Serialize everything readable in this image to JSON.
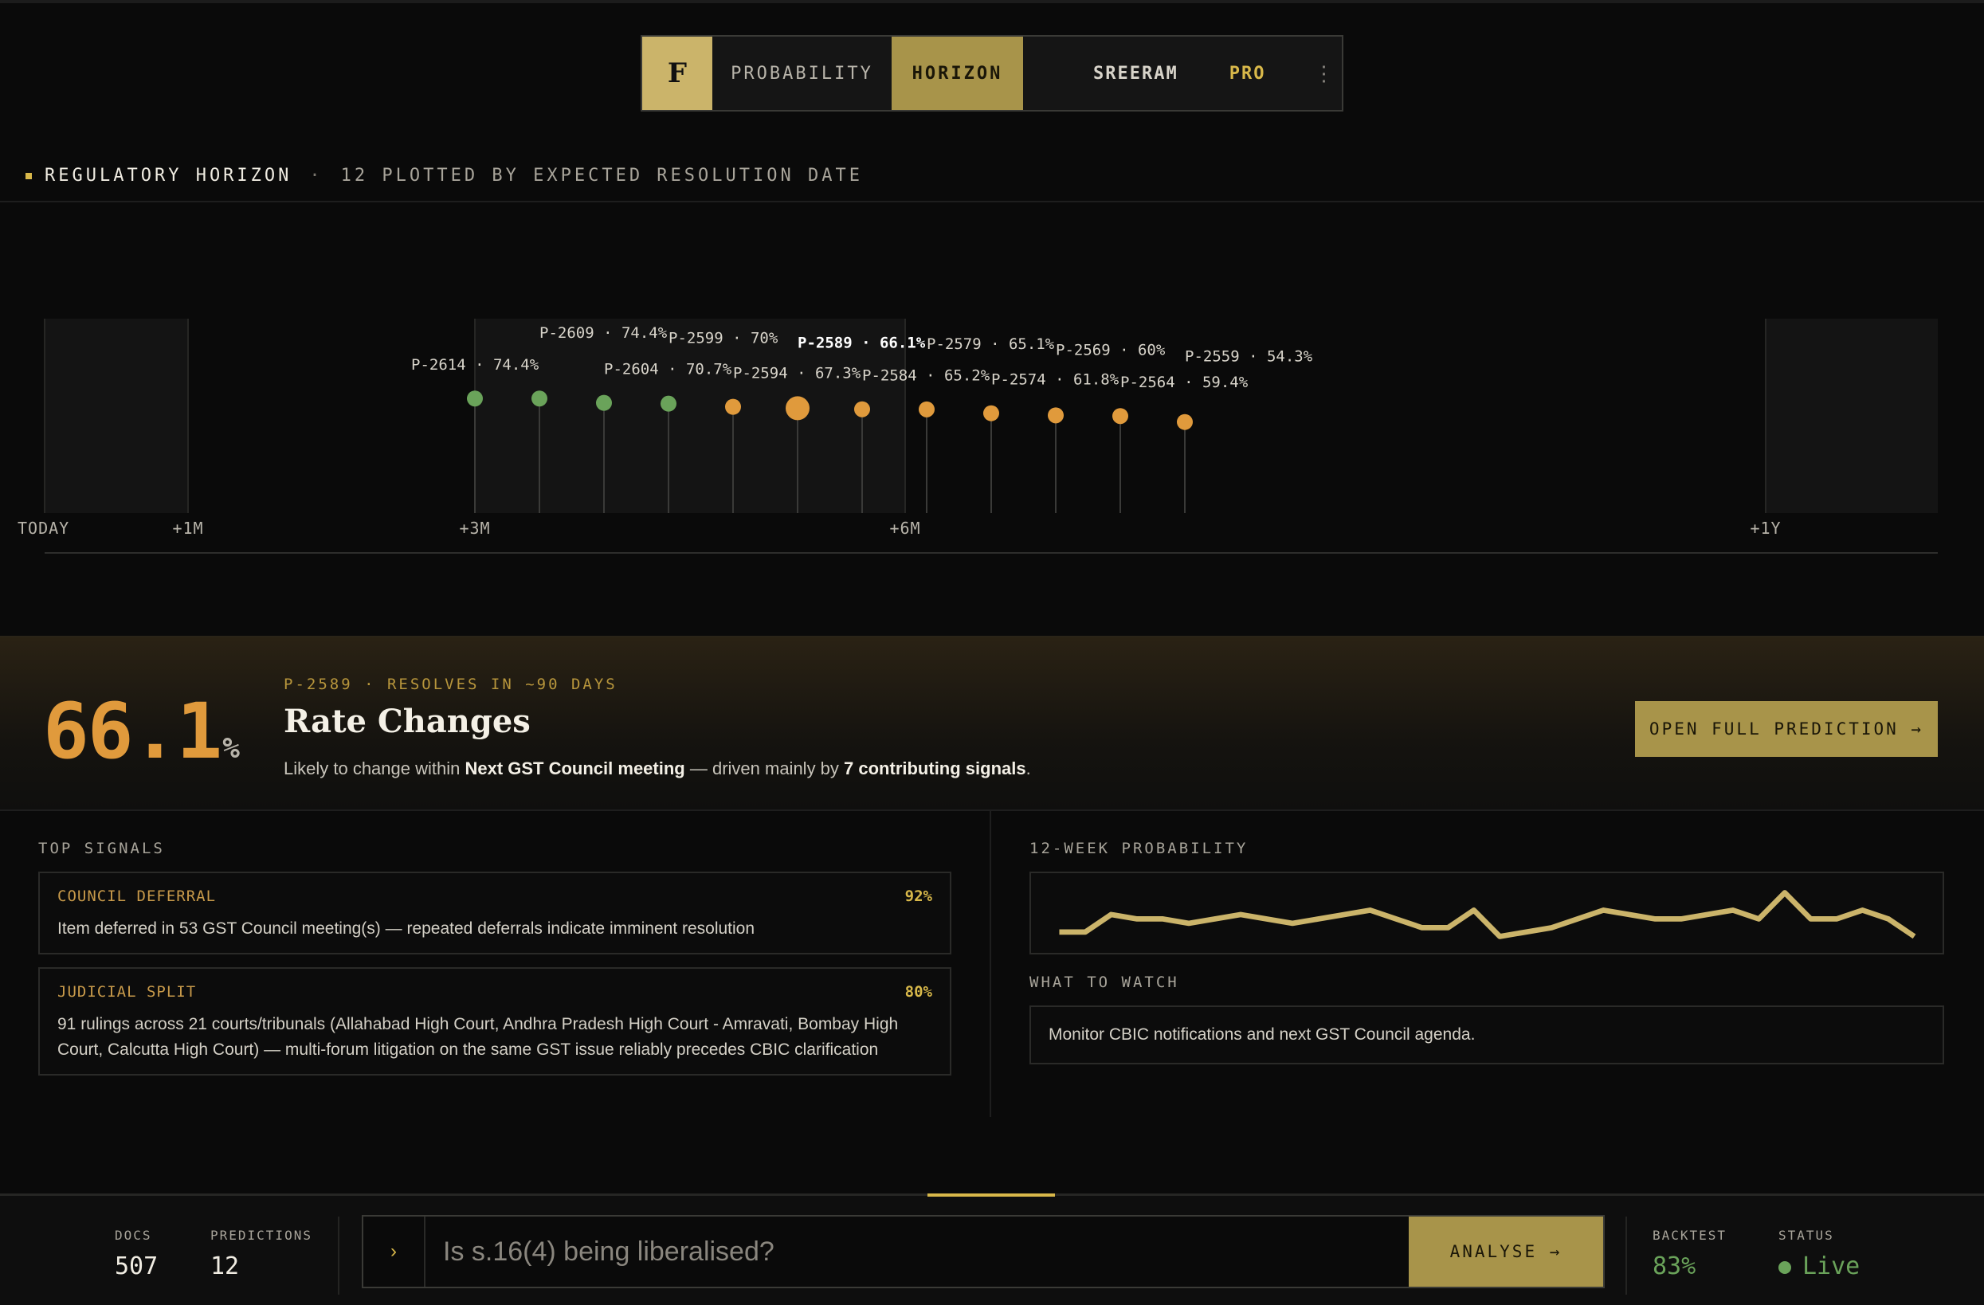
{
  "nav": {
    "logo": "F",
    "tabs": [
      {
        "label": "PROBABILITY"
      },
      {
        "label": "HORIZON"
      }
    ],
    "user": "SREERAM",
    "plan": "PRO",
    "menu_glyph": "⋮"
  },
  "section": {
    "title": "REGULATORY HORIZON",
    "separator": "·",
    "subtitle": "12 PLOTTED BY EXPECTED RESOLUTION DATE"
  },
  "chart_data": {
    "type": "scatter",
    "title": "",
    "xlabel": "",
    "ylabel": "",
    "x_ticks": [
      {
        "label": "TODAY",
        "months": 0
      },
      {
        "label": "+1M",
        "months": 1
      },
      {
        "label": "+3M",
        "months": 3
      },
      {
        "label": "+6M",
        "months": 6
      },
      {
        "label": "+1Y",
        "months": 12
      }
    ],
    "xlim_months": [
      0,
      13.2
    ],
    "points": [
      {
        "id": "P-2614",
        "label": "P-2614 · 74.4%",
        "months": 3.0,
        "probability": 74.4,
        "status": "green"
      },
      {
        "id": "P-2609",
        "label": "P-2609 · 74.4%",
        "months": 3.45,
        "probability": 74.4,
        "status": "green"
      },
      {
        "id": "P-2604",
        "label": "P-2604 · 70.7%",
        "months": 3.9,
        "probability": 70.7,
        "status": "green"
      },
      {
        "id": "P-2599",
        "label": "P-2599 · 70%",
        "months": 4.35,
        "probability": 70,
        "status": "green"
      },
      {
        "id": "P-2594",
        "label": "P-2594 · 67.3%",
        "months": 4.8,
        "probability": 67.3,
        "status": "orange"
      },
      {
        "id": "P-2589",
        "label": "P-2589 · 66.1%",
        "months": 5.25,
        "probability": 66.1,
        "status": "orange",
        "selected": true
      },
      {
        "id": "P-2584",
        "label": "P-2584 · 65.2%",
        "months": 5.7,
        "probability": 65.2,
        "status": "orange"
      },
      {
        "id": "P-2579",
        "label": "P-2579 · 65.1%",
        "months": 6.15,
        "probability": 65.1,
        "status": "orange"
      },
      {
        "id": "P-2574",
        "label": "P-2574 · 61.8%",
        "months": 6.6,
        "probability": 61.8,
        "status": "orange"
      },
      {
        "id": "P-2569",
        "label": "P-2569 · 60%",
        "months": 7.05,
        "probability": 60,
        "status": "orange"
      },
      {
        "id": "P-2564",
        "label": "P-2564 · 59.4%",
        "months": 7.5,
        "probability": 59.4,
        "status": "orange"
      },
      {
        "id": "P-2559",
        "label": "P-2559 · 54.3%",
        "months": 7.95,
        "probability": 54.3,
        "status": "orange"
      }
    ],
    "colors": {
      "green": "#6aa35a",
      "orange": "#e09a3c",
      "stem": "#3a3a38"
    }
  },
  "focus": {
    "value": "66.1",
    "unit": "%",
    "eyebrow": "P-2589 · RESOLVES IN ~90 DAYS",
    "title": "Rate Changes",
    "desc_pre": "Likely to change within ",
    "desc_event": "Next GST Council meeting",
    "desc_mid": " — driven mainly by ",
    "desc_signals": "7 contributing signals",
    "desc_post": ".",
    "button": "OPEN FULL PREDICTION →"
  },
  "signals": {
    "label": "TOP SIGNALS",
    "items": [
      {
        "kind": "COUNCIL DEFERRAL",
        "value": "92%",
        "text": "Item deferred in 53 GST Council meeting(s) — repeated deferrals indicate imminent resolution"
      },
      {
        "kind": "JUDICIAL SPLIT",
        "value": "80%",
        "text": "91 rulings across 21 courts/tribunals (Allahabad High Court, Andhra Pradesh High Court - Amravati, Bombay High Court, Calcutta High Court) — multi-forum litigation on the same GST issue reliably precedes CBIC clarification"
      }
    ]
  },
  "weekly": {
    "label": "12-WEEK PROBABILITY",
    "values": [
      62,
      62,
      66,
      65,
      65,
      64,
      65,
      66,
      65,
      64,
      65,
      66,
      67,
      65,
      63,
      63,
      67,
      61,
      62,
      63,
      65,
      67,
      66,
      65,
      65,
      66,
      67,
      65,
      71,
      65,
      65,
      67,
      65,
      61
    ]
  },
  "watch": {
    "label": "WHAT TO WATCH",
    "text": "Monitor CBIC notifications and next GST Council agenda."
  },
  "footer": {
    "docs_label": "DOCS",
    "docs_value": "507",
    "predictions_label": "PREDICTIONS",
    "predictions_value": "12",
    "prompt_glyph": "›",
    "query_placeholder": "Is s.16(4) being liberalised?",
    "analyse_label": "ANALYSE →",
    "backtest_label": "BACKTEST",
    "backtest_value": "83%",
    "status_label": "STATUS",
    "status_value": "Live"
  }
}
